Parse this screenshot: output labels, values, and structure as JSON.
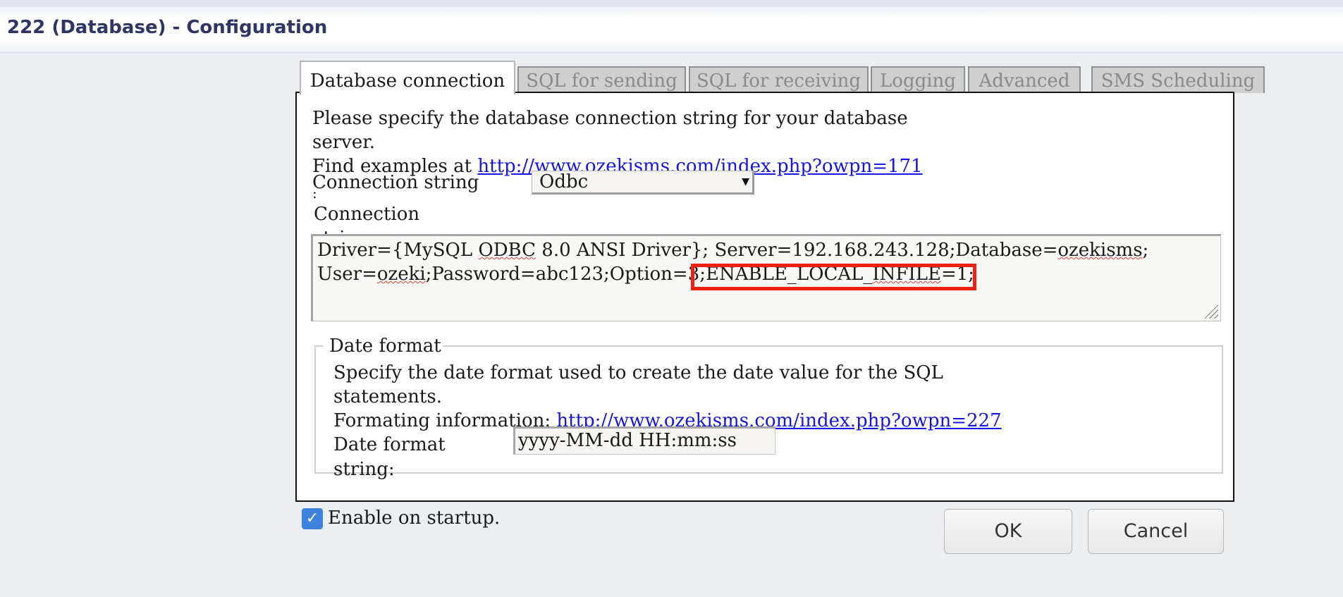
{
  "window": {
    "title": "222 (Database) - Configuration"
  },
  "tabs": [
    {
      "label": "Database connection",
      "active": true
    },
    {
      "label": "SQL for sending",
      "active": false
    },
    {
      "label": "SQL for receiving",
      "active": false
    },
    {
      "label": "Logging",
      "active": false
    },
    {
      "label": "Advanced",
      "active": false
    },
    {
      "label": "SMS Scheduling",
      "active": false
    }
  ],
  "connection": {
    "intro_line1": "Please specify the database connection string for your database",
    "intro_line2": "server.",
    "examples_prefix": "Find examples at ",
    "examples_link": "http://www.ozekisms.com/index.php?owpn=171",
    "type_label": "Connection string",
    "type_label_tail": ":",
    "type_value": "Odbc",
    "string_label_line1": "Connection",
    "string_label_line2": "string:",
    "string_value_line1_a": "Driver={MySQL ",
    "string_value_line1_b": "ODBC",
    "string_value_line1_c": " 8.0 ANSI Driver}; Server=192.168.243.128;Database=",
    "string_value_line1_d": "ozekisms",
    "string_value_line1_e": ";",
    "string_value_line2_a": "User=",
    "string_value_line2_b": "ozeki",
    "string_value_line2_c": ";Password=abc123;Option=3",
    "string_value_line2_d": ";ENABLE_LOCAL_",
    "string_value_line2_e": "INFILE",
    "string_value_line2_f": "=1;"
  },
  "date_format": {
    "legend": "Date format",
    "desc_line1": "Specify the date format used to create the date value for the SQL",
    "desc_line2": "statements.",
    "info_prefix": "Formating information: ",
    "info_link": "http://www.ozekisms.com/index.php?owpn=227",
    "field_label_line1": "Date format",
    "field_label_line2": "string:",
    "field_value": "yyyy-MM-dd HH:mm:ss"
  },
  "startup": {
    "label": "Enable on startup.",
    "checked": true
  },
  "buttons": {
    "ok": "OK",
    "cancel": "Cancel"
  },
  "colors": {
    "title": "#2f3564",
    "link": "#1515e6",
    "highlight": "#ee2212",
    "checkbox": "#3e84df"
  }
}
